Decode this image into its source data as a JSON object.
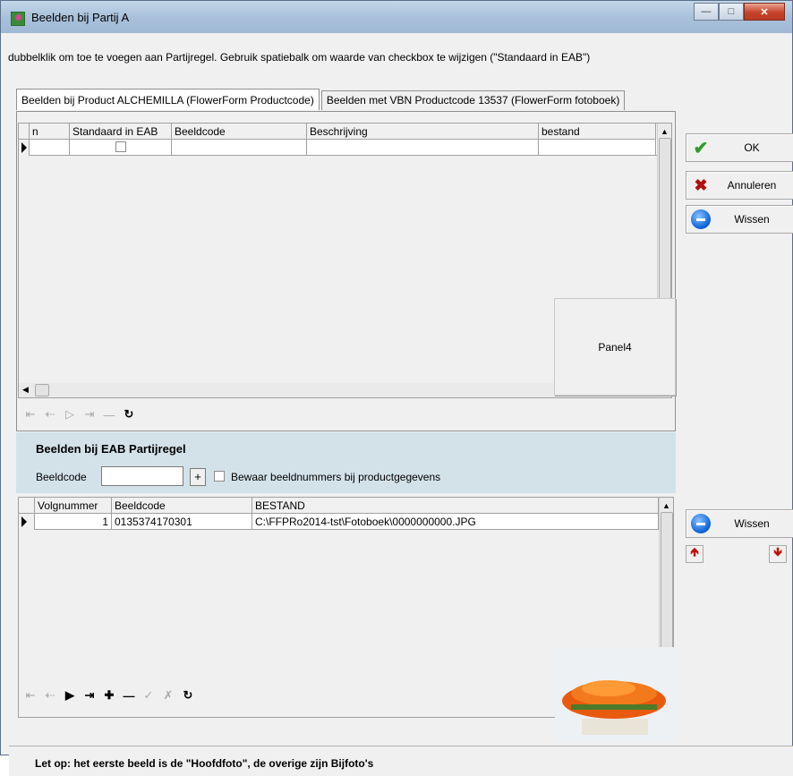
{
  "window": {
    "title": "Beelden bij Partij A"
  },
  "instruction": "dubbelklik om toe te voegen aan Partijregel. Gebruik spatiebalk om waarde van checkbox te wijzigen (\"Standaard in EAB\")",
  "tabs": [
    {
      "label": "Beelden bij Product ALCHEMILLA (FlowerForm Productcode)",
      "active": true
    },
    {
      "label": "Beelden met VBN Productcode 13537 (FlowerForm fotoboek)",
      "active": false
    }
  ],
  "grid1": {
    "columns": [
      "n",
      "Standaard in EAB",
      "Beeldcode",
      "Beschrijving",
      "bestand"
    ]
  },
  "panel4": {
    "label": "Panel4"
  },
  "buttons": {
    "ok": "OK",
    "cancel": "Annuleren",
    "clear_top": "Wissen",
    "clear_bottom": "Wissen"
  },
  "eab": {
    "heading": "Beelden bij EAB Partijregel",
    "beeldcode_label": "Beeldcode",
    "beeldcode_value": "",
    "plus": "+",
    "checkbox_label": "Bewaar beeldnummers bij productgegevens"
  },
  "grid2": {
    "columns": [
      "Volgnummer",
      "Beeldcode",
      "BESTAND"
    ],
    "rows": [
      {
        "volgnummer": "1",
        "beeldcode": "0135374170301",
        "bestand": "C:\\FFPRo2014-tst\\Fotoboek\\0000000000.JPG"
      }
    ]
  },
  "footer": "Let op: het eerste beeld is de \"Hoofdfoto\", de overige zijn Bijfoto's",
  "icons": {
    "nav1": [
      "first-icon",
      "prior-icon",
      "next-icon",
      "last-icon",
      "insert-icon",
      "refresh-icon"
    ],
    "nav2": [
      "first-icon",
      "prior-icon",
      "next-icon",
      "last-icon",
      "insert-icon",
      "delete-icon",
      "post-icon",
      "cancel-icon",
      "refresh-icon"
    ]
  }
}
